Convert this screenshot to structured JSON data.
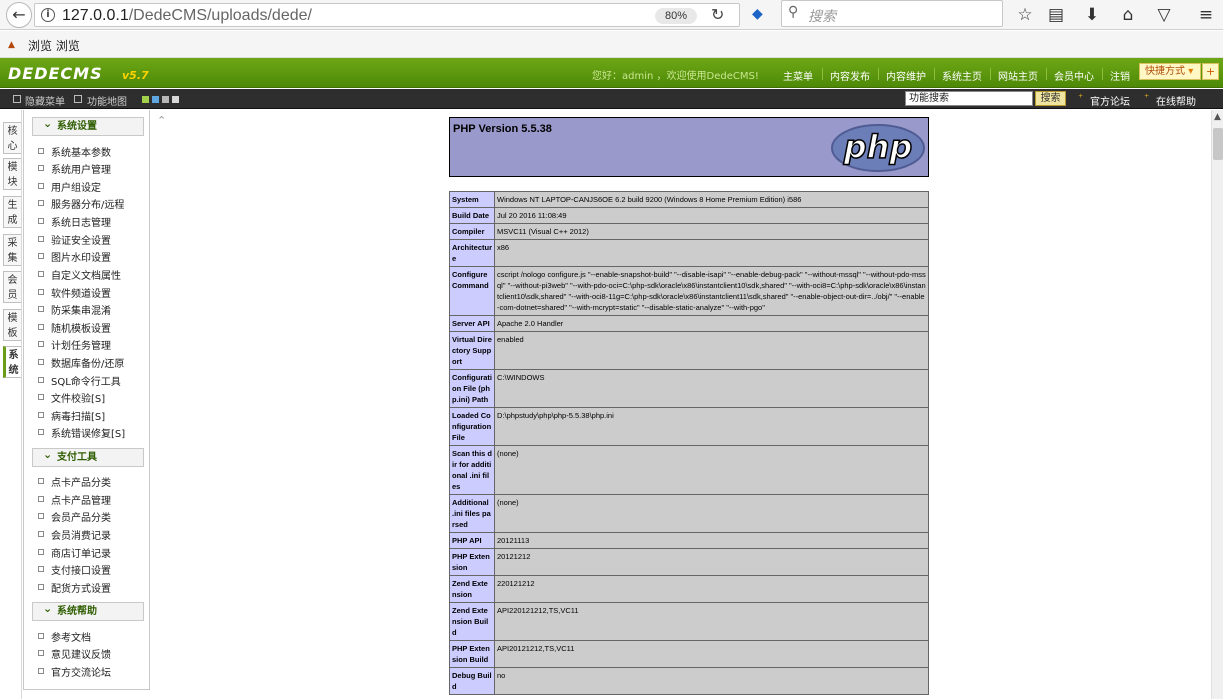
{
  "browser": {
    "url_host": "127.0.0.1",
    "url_path": "/DedeCMS/uploads/dede/",
    "zoom": "80%",
    "search_placeholder": "搜索",
    "bookmark_label": "浏览 浏览"
  },
  "header": {
    "logo": "DEDECMS",
    "version": "v5.7",
    "welcome": "您好：admin ，欢迎使用DedeCMS!",
    "nav": [
      "主菜单",
      "内容发布",
      "内容维护",
      "系统主页",
      "网站主页",
      "会员中心",
      "注销"
    ],
    "quick": "快捷方式",
    "quick_plus": "+"
  },
  "toolbar": {
    "hide_menu": "隐藏菜单",
    "function_map": "功能地图",
    "search_value": "功能搜索",
    "search_button": "搜索",
    "forum": "官方论坛",
    "help": "在线帮助"
  },
  "side_tabs": [
    "核心",
    "模块",
    "生成",
    "采集",
    "会员",
    "模板",
    "系统"
  ],
  "menu": {
    "groups": [
      {
        "title": "系统设置",
        "items": [
          "系统基本参数",
          "系统用户管理",
          "用户组设定",
          "服务器分布/远程",
          "系统日志管理",
          "验证安全设置",
          "图片水印设置",
          "自定义文档属性",
          "软件频道设置",
          "防采集串混淆",
          "随机模板设置",
          "计划任务管理",
          "数据库备份/还原",
          "SQL命令行工具",
          "文件校验[S]",
          "病毒扫描[S]",
          "系统错误修复[S]"
        ]
      },
      {
        "title": "支付工具",
        "items": [
          "点卡产品分类",
          "点卡产品管理",
          "会员产品分类",
          "会员消费记录",
          "商店订单记录",
          "支付接口设置",
          "配货方式设置"
        ]
      },
      {
        "title": "系统帮助",
        "items": [
          "参考文档",
          "意见建议反馈",
          "官方交流论坛"
        ]
      }
    ]
  },
  "phpinfo": {
    "title": "PHP Version 5.5.38",
    "logo_text": "php",
    "rows": [
      {
        "k": "System",
        "v": "Windows NT LAPTOP-CANJS6OE 6.2 build 9200 (Windows 8 Home Premium Edition) i586"
      },
      {
        "k": "Build Date",
        "v": "Jul 20 2016 11:08:49"
      },
      {
        "k": "Compiler",
        "v": "MSVC11 (Visual C++ 2012)"
      },
      {
        "k": "Architecture",
        "v": "x86"
      },
      {
        "k": "Configure Command",
        "v": "cscript /nologo configure.js \"--enable-snapshot-build\" \"--disable-isapi\" \"--enable-debug-pack\" \"--without-mssql\" \"--without-pdo-mssql\" \"--without-pi3web\" \"--with-pdo-oci=C:\\php-sdk\\oracle\\x86\\instantclient10\\sdk,shared\" \"--with-oci8=C:\\php-sdk\\oracle\\x86\\instantclient10\\sdk,shared\" \"--with-oci8-11g=C:\\php-sdk\\oracle\\x86\\instantclient11\\sdk,shared\" \"--enable-object-out-dir=../obj/\" \"--enable-com-dotnet=shared\" \"--with-mcrypt=static\" \"--disable-static-analyze\" \"--with-pgo\""
      },
      {
        "k": "Server API",
        "v": "Apache 2.0 Handler"
      },
      {
        "k": "Virtual Directory Support",
        "v": "enabled"
      },
      {
        "k": "Configuration File (php.ini) Path",
        "v": "C:\\WINDOWS"
      },
      {
        "k": "Loaded Configuration File",
        "v": "D:\\phpstudy\\php\\php-5.5.38\\php.ini"
      },
      {
        "k": "Scan this dir for additional .ini files",
        "v": "(none)"
      },
      {
        "k": "Additional .ini files parsed",
        "v": "(none)"
      },
      {
        "k": "PHP API",
        "v": "20121113"
      },
      {
        "k": "PHP Extension",
        "v": "20121212"
      },
      {
        "k": "Zend Extension",
        "v": "220121212"
      },
      {
        "k": "Zend Extension Build",
        "v": "API220121212,TS,VC11"
      },
      {
        "k": "PHP Extension Build",
        "v": "API20121212,TS,VC11"
      },
      {
        "k": "Debug Build",
        "v": "no"
      }
    ]
  }
}
